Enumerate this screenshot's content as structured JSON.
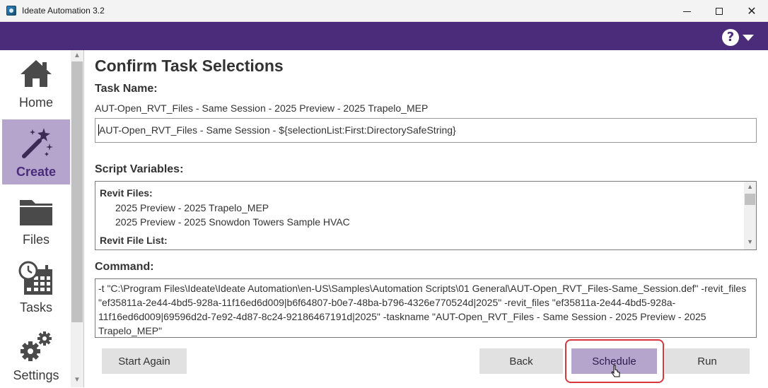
{
  "window": {
    "title": "Ideate Automation 3.2",
    "minimize_glyph": "",
    "maximize_glyph": "",
    "close_glyph": "✕"
  },
  "header": {
    "help_glyph": "?",
    "accent_color": "#4b2c7a"
  },
  "sidebar": {
    "items": [
      {
        "label": "Home",
        "icon": "home-icon",
        "active": false
      },
      {
        "label": "Create",
        "icon": "magic-wand-icon",
        "active": true
      },
      {
        "label": "Files",
        "icon": "folder-icon",
        "active": false
      },
      {
        "label": "Tasks",
        "icon": "calendar-clock-icon",
        "active": false
      },
      {
        "label": "Settings",
        "icon": "gears-icon",
        "active": false
      }
    ]
  },
  "main": {
    "title": "Confirm Task Selections",
    "task_name_label": "Task Name:",
    "task_name_value": "AUT-Open_RVT_Files - Same Session - 2025 Preview - 2025 Trapelo_MEP",
    "task_name_input": "AUT-Open_RVT_Files - Same Session - ${selectionList:First:DirectorySafeString}",
    "script_variables_label": "Script Variables:",
    "script_variables": {
      "revit_files_header": "Revit Files:",
      "revit_files": [
        "2025 Preview - 2025 Trapelo_MEP",
        "2025 Preview - 2025 Snowdon Towers Sample HVAC"
      ],
      "revit_file_list_header": "Revit File List:"
    },
    "command_label": "Command:",
    "command_text": "-t \"C:\\Program Files\\Ideate\\Ideate Automation\\en-US\\Samples\\Automation Scripts\\01 General\\AUT-Open_RVT_Files-Same_Session.def\" -revit_files \"ef35811a-2e44-4bd5-928a-11f16ed6d009|b6f64807-b0e7-48ba-b796-4326e770524d|2025\" -revit_files \"ef35811a-2e44-4bd5-928a-11f16ed6d009|69596d2d-7e92-4d87-8c24-92186467191d|2025\" -taskname \"AUT-Open_RVT_Files - Same Session - 2025 Preview - 2025 Trapelo_MEP\""
  },
  "buttons": {
    "start_again": "Start Again",
    "back": "Back",
    "schedule": "Schedule",
    "run": "Run"
  }
}
